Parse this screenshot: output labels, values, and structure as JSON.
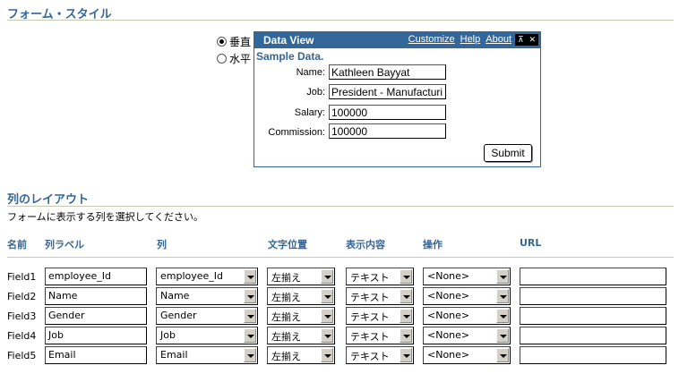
{
  "form_style": {
    "title": "フォーム・スタイル",
    "options": [
      "垂直",
      "水平"
    ],
    "selected": "垂直"
  },
  "popup": {
    "title": "Data View",
    "links": [
      "Customize",
      "Help",
      "About"
    ],
    "ctrl_icons": [
      "pin-icon",
      "close-icon"
    ],
    "subtitle": "Sample Data.",
    "fields": [
      {
        "label": "Name:",
        "value": "Kathleen Bayyat"
      },
      {
        "label": "Job:",
        "value": "President - Manufacturi"
      },
      {
        "label": "Salary:",
        "value": "100000"
      },
      {
        "label": "Commission:",
        "value": "100000"
      }
    ],
    "submit": "Submit"
  },
  "layout": {
    "title": "列のレイアウト",
    "instruction": "フォームに表示する列を選択してください。",
    "headers": {
      "name": "名前",
      "label": "列ラベル",
      "column": "列",
      "align": "文字位置",
      "display": "表示内容",
      "action": "操作",
      "url": "URL"
    },
    "rows": [
      {
        "name": "Field1",
        "label": "employee_Id",
        "column": "employee_Id",
        "align": "左揃え",
        "display": "テキスト",
        "action": "<None>",
        "url": ""
      },
      {
        "name": "Field2",
        "label": "Name",
        "column": "Name",
        "align": "左揃え",
        "display": "テキスト",
        "action": "<None>",
        "url": ""
      },
      {
        "name": "Field3",
        "label": "Gender",
        "column": "Gender",
        "align": "左揃え",
        "display": "テキスト",
        "action": "<None>",
        "url": ""
      },
      {
        "name": "Field4",
        "label": "Job",
        "column": "Job",
        "align": "左揃え",
        "display": "テキスト",
        "action": "<None>",
        "url": ""
      },
      {
        "name": "Field5",
        "label": "Email",
        "column": "Email",
        "align": "左揃え",
        "display": "テキスト",
        "action": "<None>",
        "url": ""
      }
    ]
  },
  "colors": {
    "accent": "#336699",
    "rule": "#c9cbb3"
  }
}
